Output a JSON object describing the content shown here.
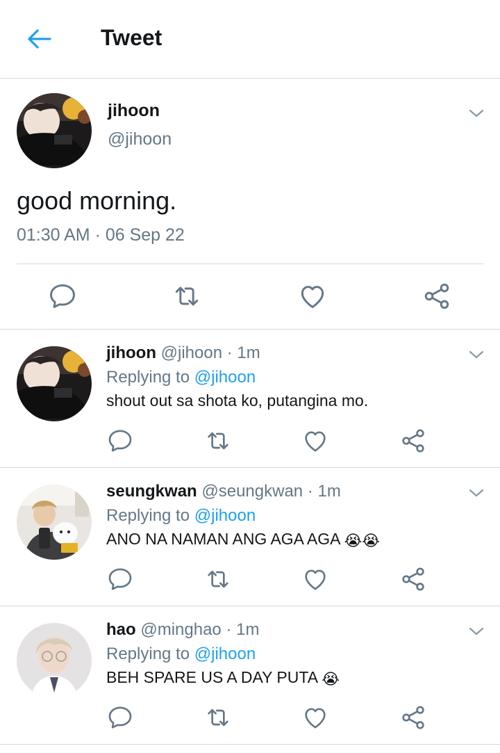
{
  "header": {
    "title": "Tweet"
  },
  "main_tweet": {
    "name": "jihoon",
    "handle": "@jihoon",
    "text": "good morning.",
    "timestamp": "01:30 AM · 06 Sep 22"
  },
  "replies": [
    {
      "name": "jihoon",
      "handle": "@jihoon",
      "time": "· 1m",
      "replying_label": "Replying to",
      "replying_to": "@jihoon",
      "text": "shout out sa shota ko, putangina mo.",
      "emoji": ""
    },
    {
      "name": "seungkwan",
      "handle": "@seungkwan",
      "time": "· 1m",
      "replying_label": "Replying to",
      "replying_to": "@jihoon",
      "text": "ANO NA NAMAN ANG AGA AGA",
      "emoji": "😭😭"
    },
    {
      "name": "hao",
      "handle": "@minghao",
      "time": "· 1m",
      "replying_label": "Replying to",
      "replying_to": "@jihoon",
      "text": "BEH SPARE US A DAY PUTA",
      "emoji": "😭"
    }
  ],
  "icons": {
    "back": "arrow-left-icon",
    "caret": "chevron-down-icon",
    "reply": "reply-icon",
    "retweet": "retweet-icon",
    "like": "heart-icon",
    "share": "share-icon"
  },
  "colors": {
    "accent": "#1da1f2",
    "secondary_text": "#657786",
    "divider": "#cfd9de"
  }
}
